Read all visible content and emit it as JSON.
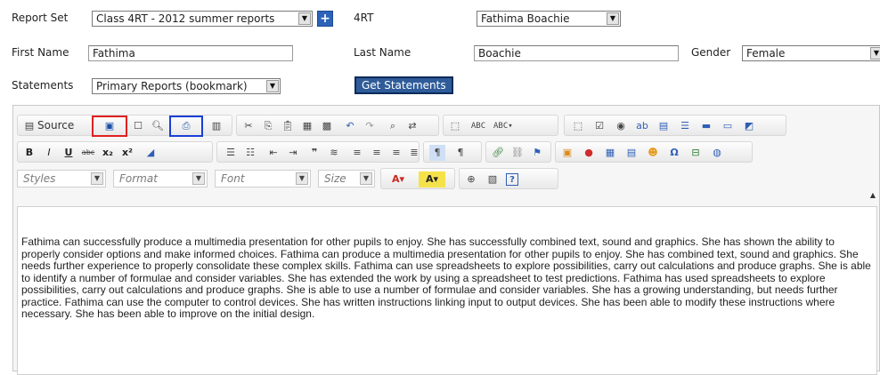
{
  "form": {
    "report_set_label": "Report Set",
    "report_set_value": "Class 4RT - 2012 summer reports",
    "add_button_label": "+",
    "class_label": "4RT",
    "student_value": "Fathima Boachie",
    "first_name_label": "First Name",
    "first_name_value": "Fathima",
    "last_name_label": "Last Name",
    "last_name_value": "Boachie",
    "gender_label": "Gender",
    "gender_value": "Female",
    "statements_label": "Statements",
    "statements_value": "Primary Reports (bookmark)",
    "get_statements_label": "Get Statements"
  },
  "editor": {
    "source_label": "Source",
    "styles_label": "Styles",
    "format_label": "Format",
    "font_label": "Font",
    "size_label": "Size",
    "content": "Fathima can successfully produce a multimedia presentation for other pupils to enjoy. She has successfully combined text, sound and graphics. She has shown the ability to properly consider options and make informed choices. Fathima can produce a multimedia presentation for other pupils to enjoy. She has combined text, sound and graphics. She needs further experience to properly consolidate these complex skills. Fathima can use spreadsheets to explore possibilities, carry out calculations and produce graphs. She is able to identify a number of formulae and consider variables. She has extended the work by using a spreadsheet to test predictions. Fathima has used spreadsheets to explore possibilities, carry out calculations and produce graphs. She is able to use a number of formulae and consider variables. She has a growing understanding, but needs further practice. Fathima can use the computer to control devices. She has written instructions linking input to output devices. She has been able to modify these instructions where necessary. She has been able to improve on the initial design."
  },
  "colors": {
    "accent_blue": "#2c63b8",
    "highlight_red": "#e02020",
    "highlight_blue": "#1a3fd6"
  }
}
